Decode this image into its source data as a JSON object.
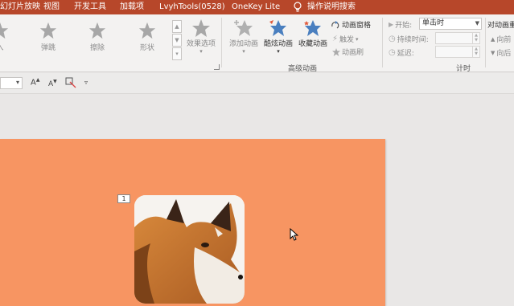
{
  "menubar": {
    "items": [
      "幻灯片放映",
      "视图",
      "开发工具",
      "加载项",
      "LvyhTools(0528)",
      "OneKey Lite",
      "操作说明搜索"
    ],
    "color": "#b7472a"
  },
  "ribbon": {
    "gallery": [
      {
        "label": "入",
        "icon": "star-icon"
      },
      {
        "label": "弹跳",
        "icon": "star-icon"
      },
      {
        "label": "擦除",
        "icon": "star-icon"
      },
      {
        "label": "形状",
        "icon": "star-icon"
      }
    ],
    "effect_options": "效果选项",
    "add_animation": "添加动画",
    "cool_animation": "酷炫动画",
    "fav_animation": "收藏动画",
    "anim_pane": "动画窗格",
    "trigger": "触发",
    "anim_painter": "动画刷",
    "advanced_group": "高级动画",
    "start_label": "开始:",
    "start_value": "单击时",
    "duration_label": "持续时间:",
    "delay_label": "延迟:",
    "timing_group": "计时",
    "reorder_label": "对动画重",
    "move_earlier": "向前",
    "move_later": "向后",
    "accent": "#4a7fbf"
  },
  "slide": {
    "background": "#f79562",
    "anim_tag": "1",
    "photo": "fox-photo"
  }
}
